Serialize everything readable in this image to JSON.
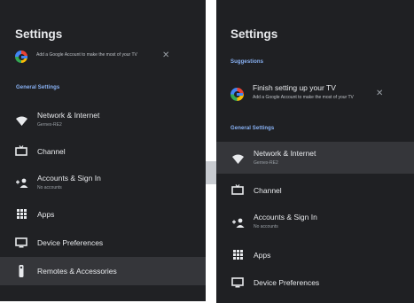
{
  "left": {
    "title": "Settings",
    "account_card": {
      "text": "Add a Google Account to make the most of your TV"
    },
    "section": "General Settings",
    "items": [
      {
        "label": "Network & Internet",
        "sub": "Gernex-RE2",
        "icon": "wifi-icon"
      },
      {
        "label": "Channel",
        "sub": "",
        "icon": "tv-icon"
      },
      {
        "label": "Accounts & Sign In",
        "sub": "No accounts",
        "icon": "add-person-icon"
      },
      {
        "label": "Apps",
        "sub": "",
        "icon": "apps-grid-icon"
      },
      {
        "label": "Device Preferences",
        "sub": "",
        "icon": "monitor-icon"
      },
      {
        "label": "Remotes & Accessories",
        "sub": "",
        "icon": "remote-icon"
      }
    ]
  },
  "right": {
    "title": "Settings",
    "suggestions_label": "Suggestions",
    "setup_card": {
      "title": "Finish setting up your TV",
      "text": "Add a Google Account to make the most of your TV"
    },
    "section": "General Settings",
    "items": [
      {
        "label": "Network & Internet",
        "sub": "Gernex-RE2",
        "icon": "wifi-icon"
      },
      {
        "label": "Channel",
        "sub": "",
        "icon": "tv-icon"
      },
      {
        "label": "Accounts & Sign In",
        "sub": "No accounts",
        "icon": "add-person-icon"
      },
      {
        "label": "Apps",
        "sub": "",
        "icon": "apps-grid-icon"
      },
      {
        "label": "Device Preferences",
        "sub": "",
        "icon": "monitor-icon"
      }
    ]
  },
  "colors": {
    "background": "#202124",
    "highlight": "#35363a",
    "accent": "#8ab4f8",
    "text": "#e8eaed",
    "subtext": "#9aa0a6"
  }
}
